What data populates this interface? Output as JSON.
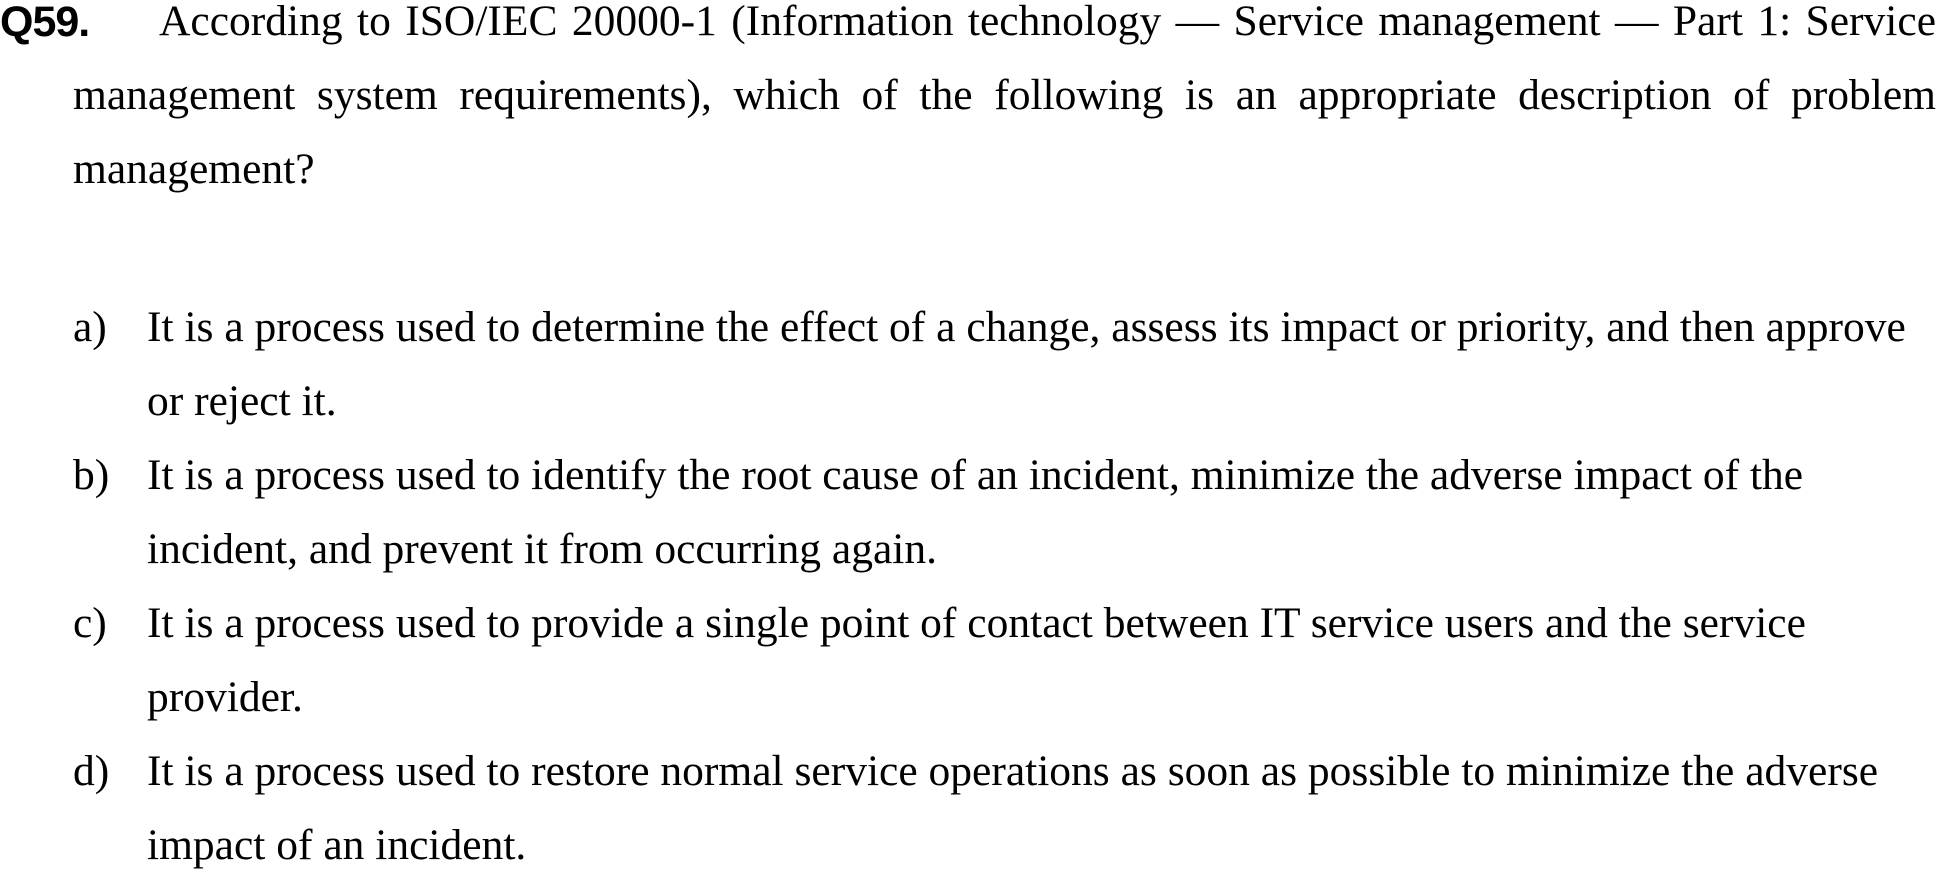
{
  "question": {
    "number": "Q59.",
    "text": "According to ISO/IEC 20000-1 (Information technology — Service management — Part 1: Service management system requirements), which of the following is an appropriate description of problem management?"
  },
  "options": [
    {
      "label": "a)",
      "text": "It is a process used to determine the effect of a change, assess its impact or priority, and then approve or reject it."
    },
    {
      "label": "b)",
      "text": "It is a process used to identify the root cause of an incident, minimize the adverse impact of the incident, and prevent it from occurring again."
    },
    {
      "label": "c)",
      "text": "It is a process used to provide a single point of contact between IT service users and the service provider."
    },
    {
      "label": "d)",
      "text": "It is a process used to restore normal service operations as soon as possible to minimize the adverse impact of an incident."
    }
  ]
}
